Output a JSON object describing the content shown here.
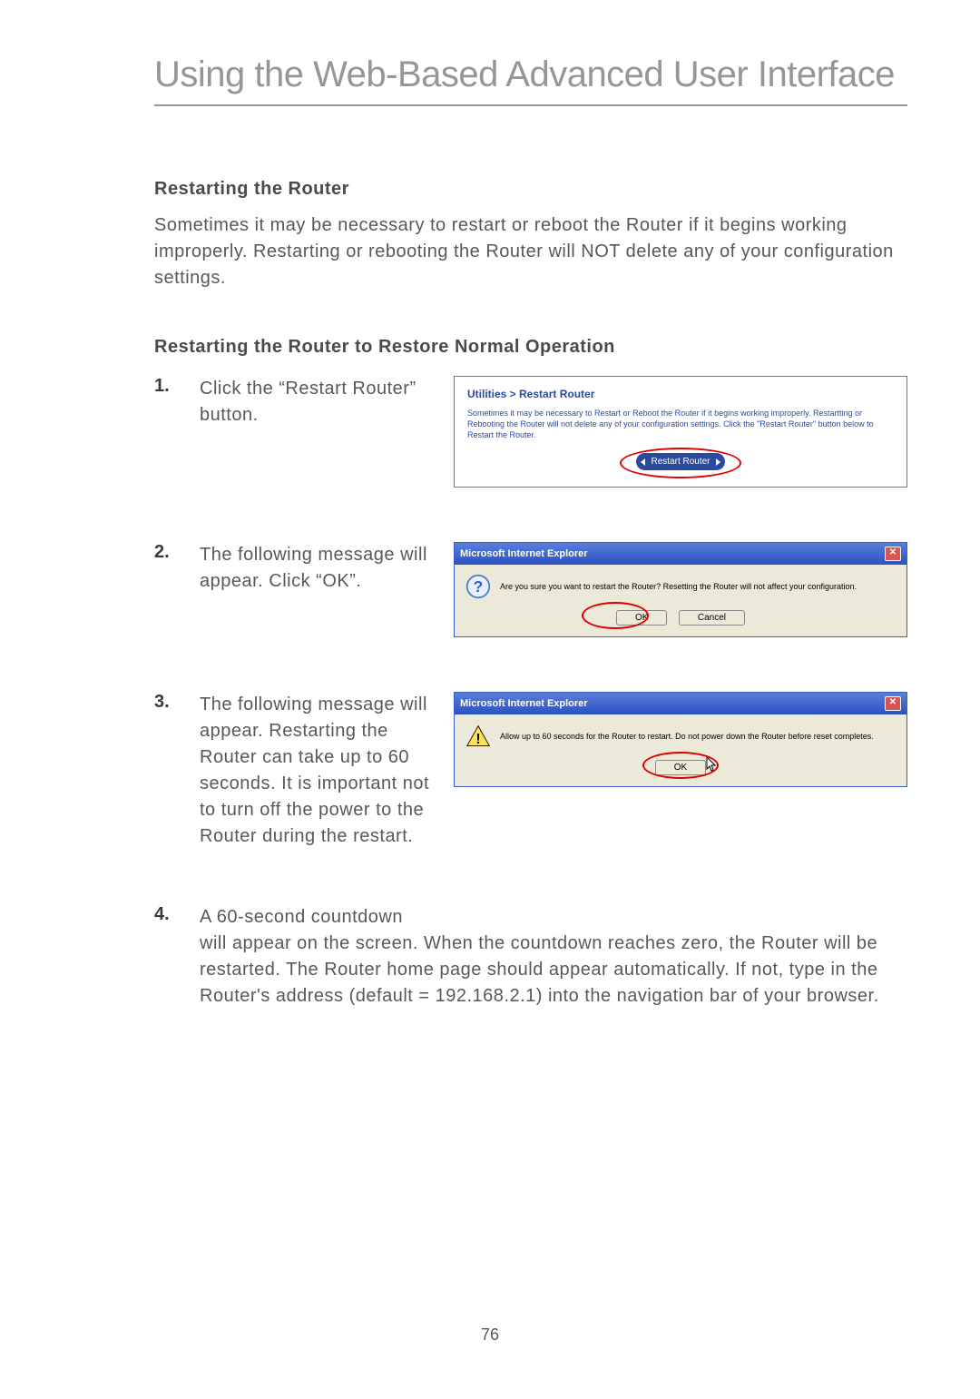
{
  "page_title": "Using the Web-Based Advanced User Interface",
  "heading1": "Restarting the Router",
  "intro": "Sometimes it may be necessary to restart or reboot the Router if it begins working improperly. Restarting or rebooting the Router will NOT delete any of your configuration settings.",
  "heading2": "Restarting the Router to Restore Normal Operation",
  "steps": {
    "1": {
      "num": "1.",
      "text": "Click the “Restart Router” button."
    },
    "2": {
      "num": "2.",
      "text": "The following message will appear. Click “OK”."
    },
    "3": {
      "num": "3.",
      "text": "The following message will appear. Restarting the Router can take up to 60 seconds. It is important not to turn off the power to the Router during the restart."
    },
    "4": {
      "num": "4.",
      "text_line1": "A 60-second countdown",
      "text_rest": "will appear on the screen. When the countdown reaches zero, the Router will be restarted. The Router home page should appear automatically. If not, type in the Router's address (default = 192.168.2.1) into the navigation bar of your browser."
    }
  },
  "panel1": {
    "title": "Utilities > Restart Router",
    "body": "Sometimes it may be necessary to Restart or Reboot the Router if it begins working improperly. Restartting or Rebooting the Router will not delete any of your configuration settings. Click the \"Restart Router\" button below to Restart the Router.",
    "button": "Restart Router"
  },
  "dialog2": {
    "title": "Microsoft Internet Explorer",
    "text": "Are you sure you want to restart the Router? Resetting the Router will not affect your configuration.",
    "ok": "OK",
    "cancel": "Cancel"
  },
  "dialog3": {
    "title": "Microsoft Internet Explorer",
    "text": "Allow up to 60 seconds for the Router to restart. Do not power down the Router before reset completes.",
    "ok": "OK"
  },
  "page_number": "76"
}
